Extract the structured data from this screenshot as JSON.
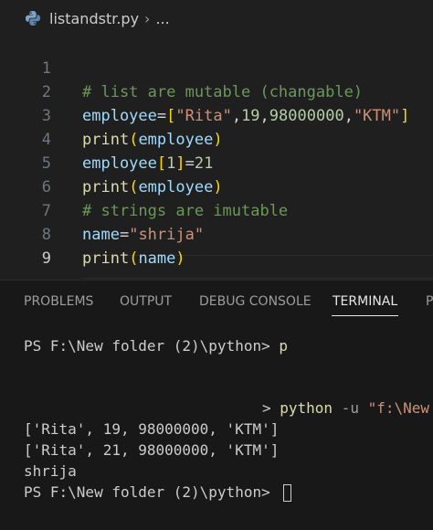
{
  "breadcrumb": {
    "file_icon": "python-icon",
    "filename": "listandstr.py",
    "separator": "›",
    "more": "..."
  },
  "editor": {
    "line_numbers": [
      "1",
      "2",
      "3",
      "4",
      "5",
      "6",
      "7",
      "8",
      "9"
    ],
    "active_line": "9",
    "lines": {
      "l1": {
        "comment": "# list are mutable (changable)"
      },
      "l2": {
        "var": "employee",
        "eq": "=",
        "open": "[",
        "s1": "\"Rita\"",
        "c1": ",",
        "n1": "19",
        "c2": ",",
        "n2": "98000000",
        "c3": ",",
        "s2": "\"KTM\"",
        "close": "]"
      },
      "l3": {
        "fn": "print",
        "open": "(",
        "arg": "employee",
        "close": ")"
      },
      "l4": {
        "var": "employee",
        "open": "[",
        "idx": "1",
        "close": "]",
        "eq": "=",
        "val": "21"
      },
      "l5": {
        "fn": "print",
        "open": "(",
        "arg": "employee",
        "close": ")"
      },
      "l6": {
        "comment": "# strings are imutable"
      },
      "l7": {
        "var": "name",
        "eq": "=",
        "str": "\"shrija\""
      },
      "l8": {
        "fn": "print",
        "open": "(",
        "arg": "name",
        "close": ")"
      }
    }
  },
  "panel": {
    "tabs": [
      "PROBLEMS",
      "OUTPUT",
      "DEBUG CONSOLE",
      "TERMINAL",
      "P"
    ],
    "active_tab": "TERMINAL"
  },
  "terminal": {
    "prompt1": "PS F:\\New folder (2)\\python> ",
    "prompt1_input": "p",
    "run_arrow": "> ",
    "run_cmd": "python",
    "run_flag": " -u ",
    "run_arg": "\"f:\\New",
    "out1": "['Rita', 19, 98000000, 'KTM']",
    "out2": "['Rita', 21, 98000000, 'KTM']",
    "out3": "shrija",
    "prompt2": "PS F:\\New folder (2)\\python> "
  }
}
